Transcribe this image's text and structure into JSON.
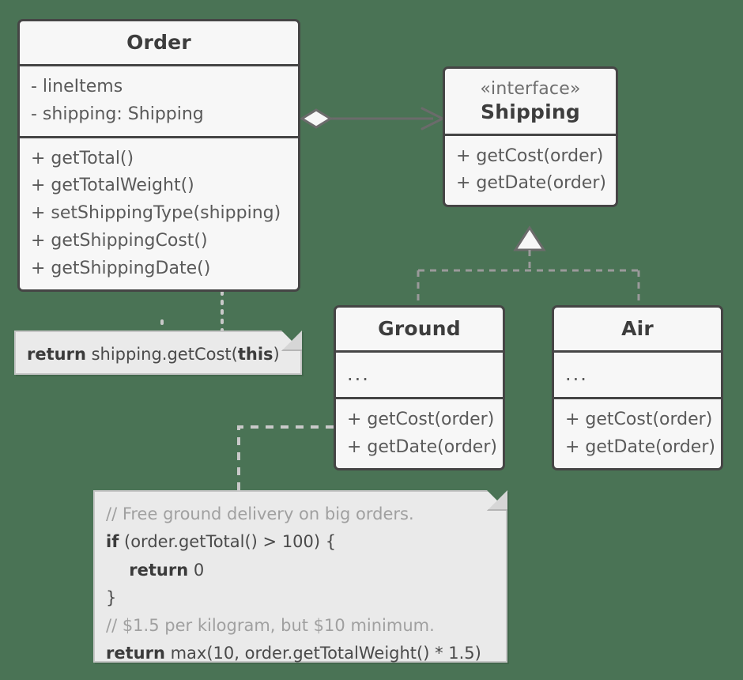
{
  "diagram": {
    "type": "uml-class-diagram",
    "background_color": "#4a7355",
    "box_fill": "#f7f7f7",
    "box_border": "#454545",
    "note_fill": "#eaeaea",
    "note_border": "#c6c6c6",
    "connector_color": "#6b6b6b",
    "note_connector_color": "#c9c9c9"
  },
  "classes": {
    "order": {
      "name": "Order",
      "attributes": [
        "- lineItems",
        "- shipping: Shipping"
      ],
      "methods": [
        "+ getTotal()",
        "+ getTotalWeight()",
        "+ setShippingType(shipping)",
        "+ getShippingCost()",
        "+ getShippingDate()"
      ]
    },
    "shipping": {
      "stereotype": "«interface»",
      "name": "Shipping",
      "methods": [
        "+ getCost(order)",
        "+ getDate(order)"
      ]
    },
    "ground": {
      "name": "Ground",
      "attributes": [
        "..."
      ],
      "methods": [
        "+ getCost(order)",
        "+ getDate(order)"
      ]
    },
    "air": {
      "name": "Air",
      "attributes": [
        "..."
      ],
      "methods": [
        "+ getCost(order)",
        "+ getDate(order)"
      ]
    }
  },
  "notes": {
    "order_cost": {
      "lines": [
        [
          {
            "text": "return",
            "style": "kw"
          },
          {
            "text": " shipping.getCost(",
            "style": "plain"
          },
          {
            "text": "this",
            "style": "kw"
          },
          {
            "text": ")",
            "style": "plain"
          }
        ]
      ]
    },
    "ground_cost": {
      "lines": [
        [
          {
            "text": "// Free ground delivery on big orders.",
            "style": "comment"
          }
        ],
        [
          {
            "text": "if",
            "style": "kw"
          },
          {
            "text": " (order.getTotal() > 100) {",
            "style": "plain"
          }
        ],
        [
          {
            "text": "    return",
            "style": "kw"
          },
          {
            "text": " 0",
            "style": "plain"
          }
        ],
        [
          {
            "text": "}",
            "style": "plain"
          }
        ],
        [
          {
            "text": "// $1.5 per kilogram, but $10 minimum.",
            "style": "comment"
          }
        ],
        [
          {
            "text": "return",
            "style": "kw"
          },
          {
            "text": " max(10, order.getTotalWeight() * 1.5)",
            "style": "plain"
          }
        ]
      ]
    }
  },
  "relationships": [
    {
      "name": "order-aggregates-shipping",
      "from": "Order",
      "to": "Shipping",
      "kind": "aggregation",
      "source_marker": "hollow-diamond",
      "target_marker": "open-arrow",
      "line": "solid"
    },
    {
      "name": "ground-implements-shipping",
      "from": "Ground",
      "to": "Shipping",
      "kind": "realization",
      "target_marker": "hollow-triangle",
      "line": "dashed"
    },
    {
      "name": "air-implements-shipping",
      "from": "Air",
      "to": "Shipping",
      "kind": "realization",
      "target_marker": "hollow-triangle",
      "line": "dashed"
    },
    {
      "name": "order-getshippingcost-note-link",
      "from": "Order.getShippingCost()",
      "to": "note:order_cost",
      "kind": "note-anchor",
      "source_marker": "small-circle",
      "line": "dotted"
    },
    {
      "name": "ground-getcost-note-link",
      "from": "Ground.getCost(order)",
      "to": "note:ground_cost",
      "kind": "note-anchor",
      "line": "dashed"
    }
  ]
}
